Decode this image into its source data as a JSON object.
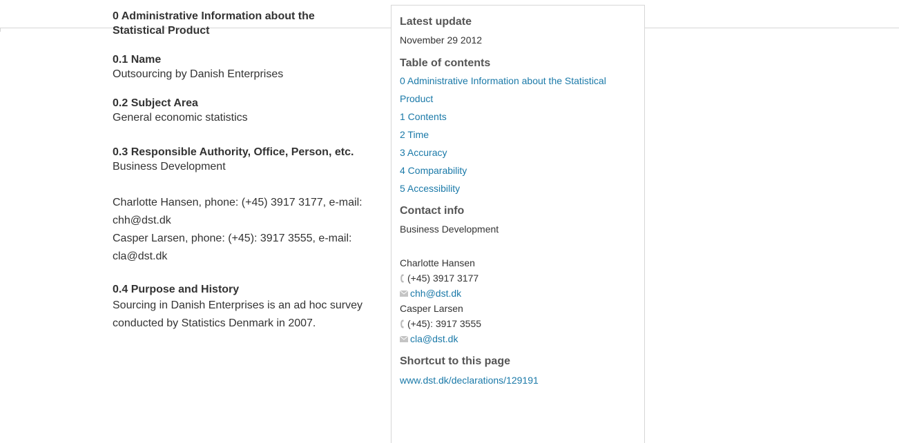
{
  "main": {
    "section0_title": "0 Administrative Information about the Statistical Product",
    "s01_title": "0.1 Name",
    "s01_text": "Outsourcing by Danish Enterprises",
    "s02_title": "0.2 Subject Area",
    "s02_text": "General economic statistics",
    "s03_title": "0.3 Responsible Authority, Office, Person, etc.",
    "s03_text": "Business Development",
    "s03_contacts": [
      "Charlotte Hansen, phone: (+45) 3917 3177, e-mail: chh@dst.dk",
      "Casper Larsen, phone: (+45): 3917 3555, e-mail: cla@dst.dk"
    ],
    "s04_title": "0.4 Purpose and History",
    "s04_text": "Sourcing in Danish Enterprises is an ad hoc survey conducted by Statistics Denmark in 2007."
  },
  "sidebar": {
    "latest_update_label": "Latest update",
    "latest_update_value": "November 29 2012",
    "toc_label": "Table of contents",
    "toc_items": [
      "0 Administrative Information about the Statistical Product",
      "1 Contents",
      "2 Time",
      "3 Accuracy",
      "4 Comparability",
      "5 Accessibility"
    ],
    "contact_label": "Contact info",
    "contact_dept": "Business Development",
    "contacts": [
      {
        "name": "Charlotte Hansen",
        "phone": "(+45) 3917 3177",
        "email": "chh@dst.dk"
      },
      {
        "name": "Casper Larsen",
        "phone": "(+45): 3917 3555",
        "email": "cla@dst.dk"
      }
    ],
    "shortcut_label": "Shortcut to this page",
    "shortcut_url": "www.dst.dk/declarations/129191"
  },
  "colors": {
    "link": "#1a79a8",
    "text": "#333333",
    "heading_sidebar": "#555555",
    "rule": "#d6d6d6",
    "icon": "#b9b9b9"
  },
  "icons": {
    "phone": "phone-icon",
    "mail": "mail-icon"
  }
}
